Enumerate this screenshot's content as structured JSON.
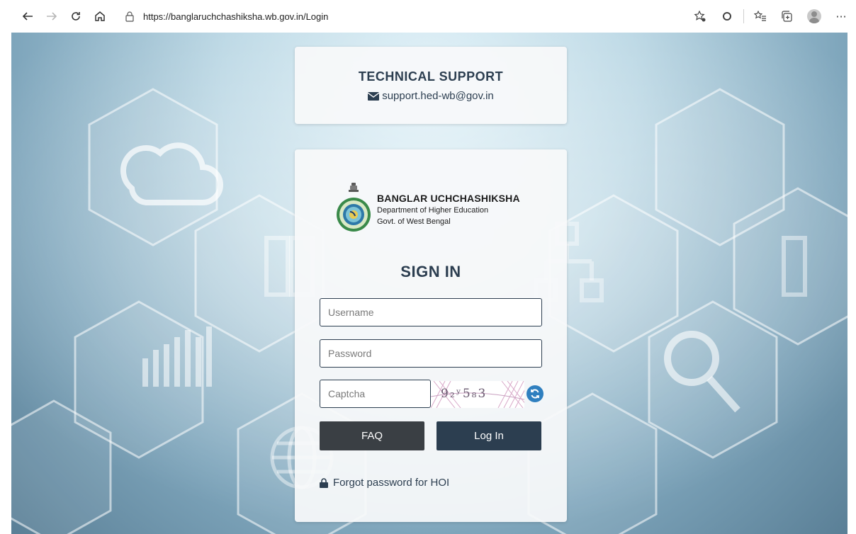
{
  "browser": {
    "url": "https://banglaruchchashiksha.wb.gov.in/Login",
    "back_icon": "back-arrow-icon",
    "forward_icon": "forward-arrow-icon",
    "refresh_icon": "refresh-icon",
    "home_icon": "home-icon",
    "more_label": "···"
  },
  "support": {
    "title": "TECHNICAL SUPPORT",
    "email": "support.hed-wb@gov.in"
  },
  "brand": {
    "title": "BANGLAR UCHCHASHIKSHA",
    "line1": "Department of Higher Education",
    "line2": "Govt. of West Bengal"
  },
  "login": {
    "heading": "SIGN IN",
    "username_placeholder": "Username",
    "password_placeholder": "Password",
    "captcha_placeholder": "Captcha",
    "captcha_text": "9₂ʸ5₈3",
    "faq_label": "FAQ",
    "login_label": "Log In",
    "forgot_label": "Forgot password for HOI"
  },
  "colors": {
    "primary": "#2c3e50",
    "faq_button": "#3a3f44",
    "refresh": "#2f7fbf"
  }
}
